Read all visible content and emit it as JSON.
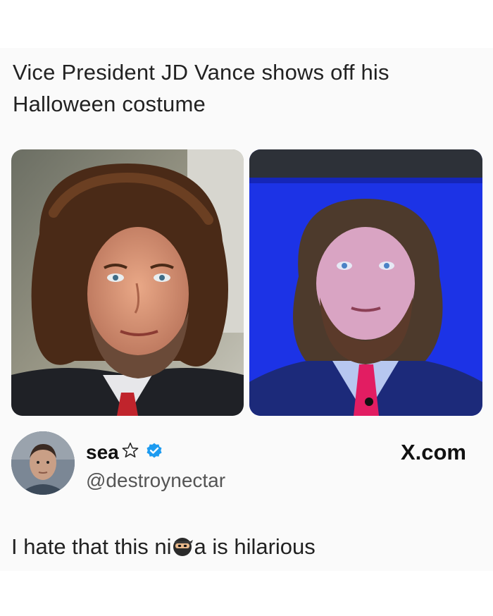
{
  "post": {
    "headline": "Vice President JD Vance shows off his Halloween costume"
  },
  "photos": {
    "left_alt": "",
    "right_alt": ""
  },
  "author": {
    "display_name": "sea",
    "handle": "@destroynectar",
    "verified": true,
    "star_icon": "outline-star-icon",
    "verified_color": "#1d9bf0"
  },
  "source": {
    "label": "X.com"
  },
  "caption": {
    "before": "I hate that this ni",
    "after": "a is hilarious",
    "emoji": "ninja-emoji"
  }
}
